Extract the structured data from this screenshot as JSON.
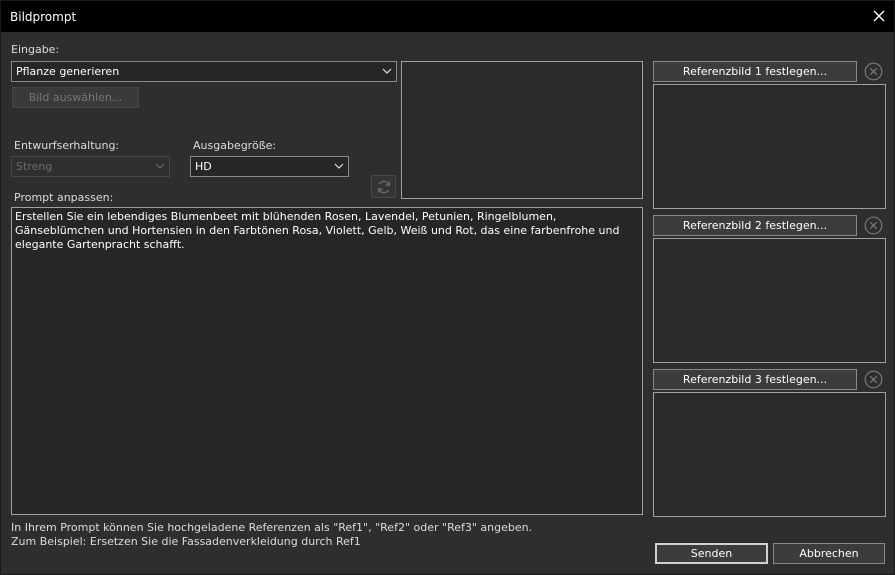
{
  "window": {
    "title": "Bildprompt",
    "close_icon": "close-icon"
  },
  "input": {
    "label": "Eingabe:",
    "selected": "Pflanze generieren",
    "select_image_button": "Bild auswählen..."
  },
  "design_retention": {
    "label": "Entwurfserhaltung:",
    "selected": "Streng"
  },
  "output_size": {
    "label": "Ausgabegröße:",
    "selected": "HD"
  },
  "prompt": {
    "label": "Prompt anpassen:",
    "text": "Erstellen Sie ein lebendiges Blumenbeet mit blühenden Rosen, Lavendel, Petunien, Ringelblumen, Gänseblümchen und Hortensien in den Farbtönen Rosa, Violett, Gelb, Weiß und Rot, das eine farbenfrohe und elegante Gartenpracht schafft."
  },
  "references": [
    {
      "button": "Referenzbild 1 festlegen..."
    },
    {
      "button": "Referenzbild 2 festlegen..."
    },
    {
      "button": "Referenzbild 3 festlegen..."
    }
  ],
  "hint": {
    "line1": "In Ihrem Prompt können Sie hochgeladene Referenzen als \"Ref1\", \"Ref2\" oder \"Ref3\" angeben.",
    "line2": "Zum Beispiel: Ersetzen Sie die Fassadenverkleidung durch Ref1"
  },
  "actions": {
    "send": "Senden",
    "cancel": "Abbrechen"
  },
  "colors": {
    "background": "#2e2e2e",
    "titlebar": "#000000",
    "border": "#a0a0a0"
  }
}
